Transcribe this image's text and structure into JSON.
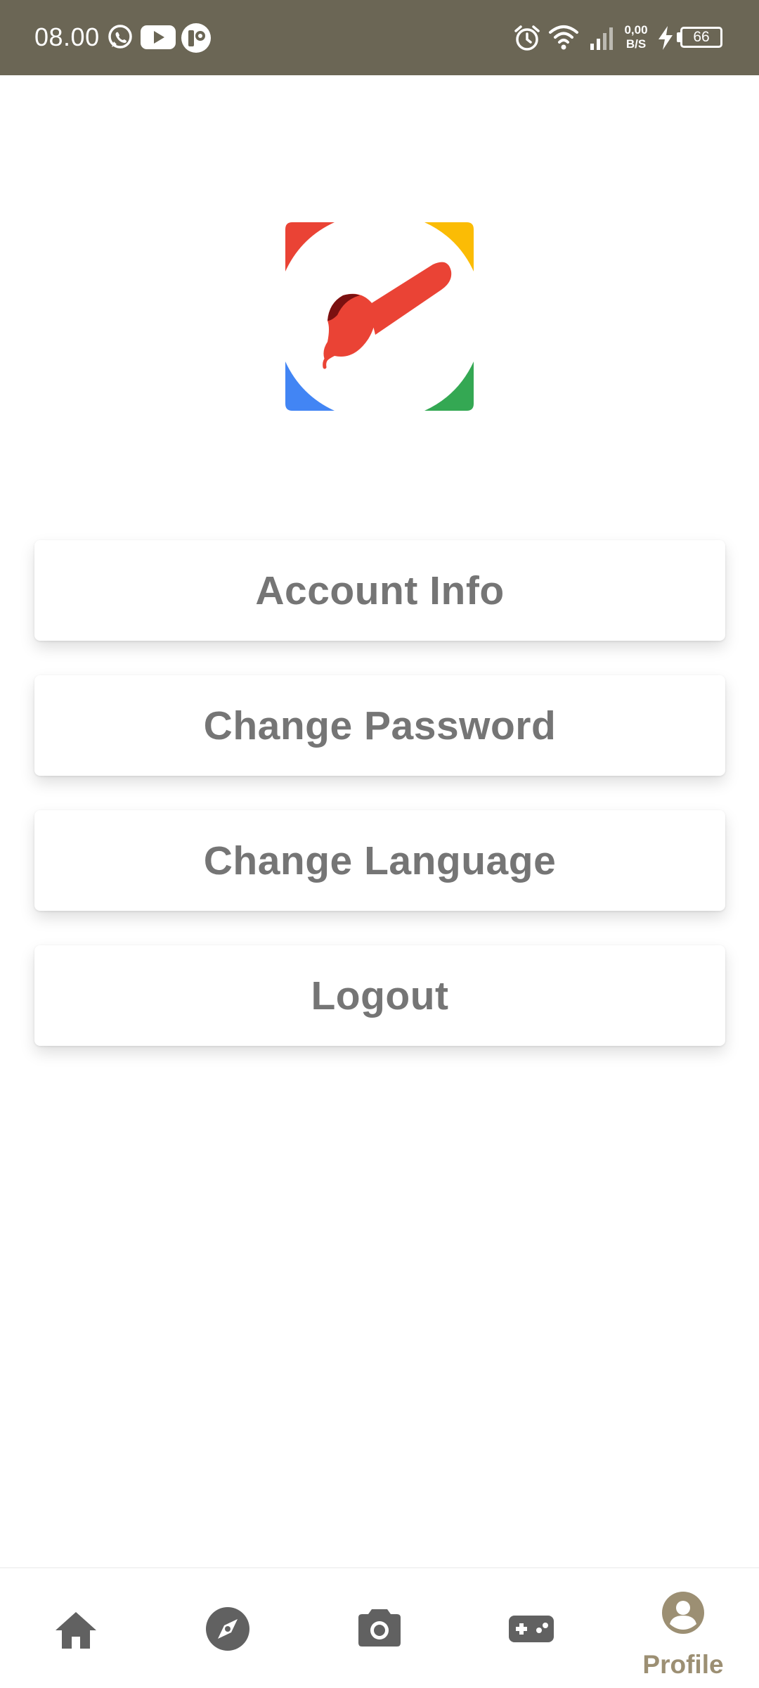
{
  "status_bar": {
    "time": "08.00",
    "net_speed_value": "0,00",
    "net_speed_unit": "B/S",
    "battery_level": "66",
    "icons": [
      "whatsapp-icon",
      "youtube-icon",
      "app-notification-icon",
      "alarm-icon",
      "wifi-icon",
      "signal-icon",
      "charging-icon",
      "battery-icon"
    ]
  },
  "logo": {
    "icon": "paintbrush-logo",
    "colors": [
      "#ea4335",
      "#fbbc05",
      "#4285f4",
      "#34a853"
    ]
  },
  "menu": {
    "items": [
      {
        "label": "Account Info"
      },
      {
        "label": "Change Password"
      },
      {
        "label": "Change Language"
      },
      {
        "label": "Logout"
      }
    ]
  },
  "bottom_nav": {
    "items": [
      {
        "icon": "home-icon",
        "label": ""
      },
      {
        "icon": "compass-icon",
        "label": ""
      },
      {
        "icon": "camera-icon",
        "label": ""
      },
      {
        "icon": "gamepad-icon",
        "label": ""
      },
      {
        "icon": "profile-icon",
        "label": "Profile",
        "active": true
      }
    ],
    "active_color": "#9c8f73",
    "inactive_color": "#616161"
  },
  "colors": {
    "status_bar_bg": "#6b6655",
    "menu_text": "#757575",
    "background": "#ffffff"
  }
}
